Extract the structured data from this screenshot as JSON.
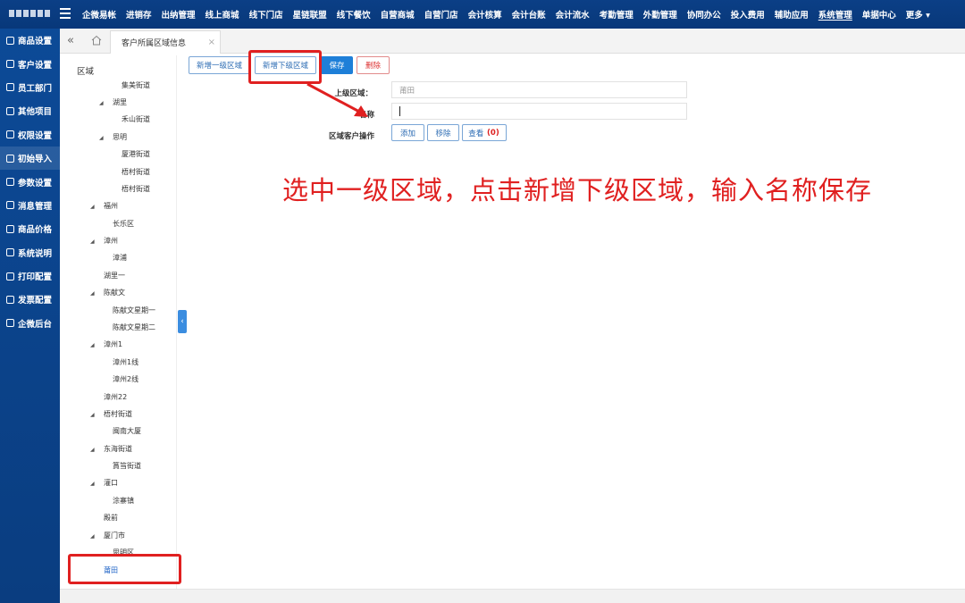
{
  "top_nav": {
    "items": [
      "企微易帐",
      "进销存",
      "出纳管理",
      "线上商城",
      "线下门店",
      "星链联盟",
      "线下餐饮",
      "自营商城",
      "自营门店",
      "会计核算",
      "会计台账",
      "会计流水",
      "考勤管理",
      "外勤管理",
      "协同办公",
      "投入费用",
      "辅助应用",
      "系统管理",
      "单据中心",
      "更多"
    ],
    "active": "系统管理"
  },
  "sidebar": {
    "items": [
      "商品设置",
      "客户设置",
      "员工部门",
      "其他项目",
      "权限设置",
      "初始导入",
      "参数设置",
      "消息管理",
      "商品价格",
      "系统说明",
      "打印配置",
      "发票配置",
      "企微后台"
    ],
    "active": "初始导入"
  },
  "tabs": {
    "title": "客户所属区域信息"
  },
  "tree": {
    "title": "区域",
    "nodes": [
      "集美街道",
      "湖里",
      "禾山街道",
      "思明",
      "厦港街道",
      "梧村街道",
      "梧村街道",
      "福州",
      "长乐区",
      "漳州",
      "漳浦",
      "湖里一",
      "陈献文",
      "陈献文星期一",
      "陈献文星期二",
      "漳州1",
      "漳州1线",
      "漳州2线",
      "漳州22",
      "梧村街道",
      "闽南大厦",
      "东海街道",
      "篔筜街道",
      "灌口",
      "涂寨镇",
      "殿前",
      "厦门市",
      "思明区",
      "莆田"
    ],
    "selected": "莆田"
  },
  "toolbar": {
    "add_top": "新增一级区域",
    "add_sub": "新增下级区域",
    "save": "保存",
    "delete": "删除"
  },
  "form": {
    "parent_label": "上级区域：",
    "parent_value": "莆田",
    "name_label": "名称",
    "name_value": "",
    "ops_label": "区域客户操作",
    "add_btn": "添加",
    "remove_btn": "移除",
    "view_btn": "查看",
    "view_count": "(0)"
  },
  "annotation": {
    "text": "选中一级区域，点击新增下级区域，输入名称保存"
  },
  "colors": {
    "nav_bg": "#0b3f86",
    "accent": "#1e7fd8",
    "annotation": "#e02020"
  }
}
